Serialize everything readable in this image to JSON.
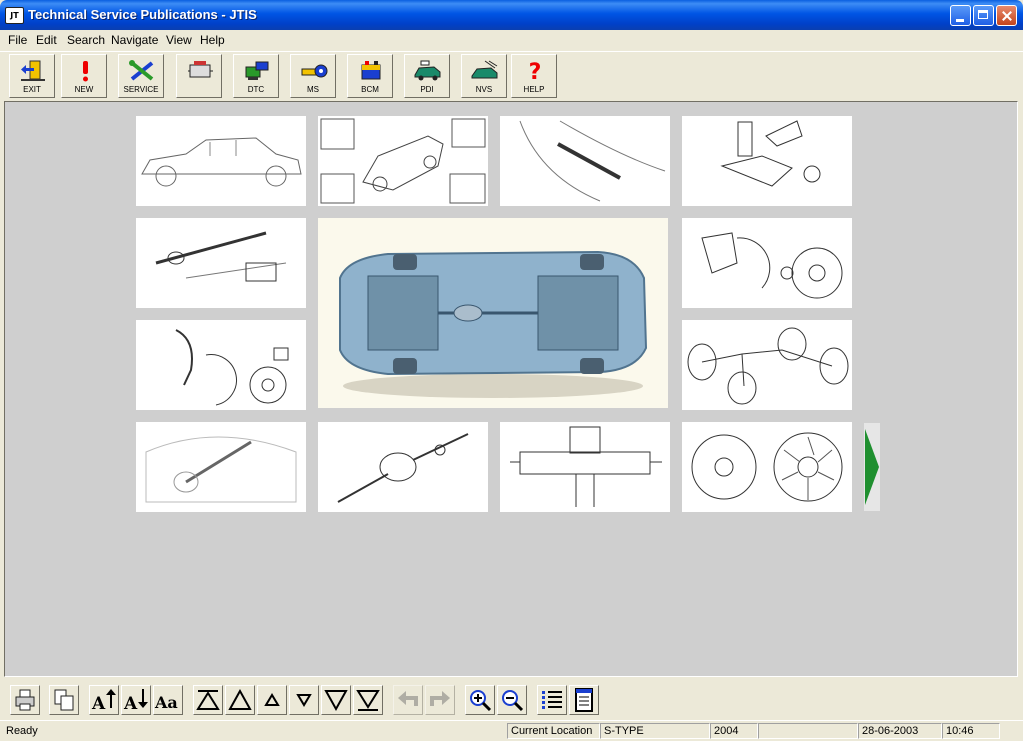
{
  "window": {
    "title": "Technical Service Publications - JTIS",
    "icon": "jtis-app-icon"
  },
  "menu": [
    "File",
    "Edit",
    "Search",
    "Navigate",
    "View",
    "Help"
  ],
  "toolbar": [
    {
      "label": "EXIT",
      "icon": "exit-door-icon"
    },
    {
      "label": "NEW",
      "icon": "exclamation-icon"
    },
    {
      "label": "SERVICE",
      "icon": "wrench-screwdriver-icon"
    },
    {
      "label": "",
      "icon": "engine-block-icon"
    },
    {
      "label": "DTC",
      "icon": "dtc-connector-icon"
    },
    {
      "label": "MS",
      "icon": "ms-tool-icon"
    },
    {
      "label": "BCM",
      "icon": "battery-icon"
    },
    {
      "label": "PDI",
      "icon": "car-inspection-icon"
    },
    {
      "label": "NVS",
      "icon": "nvs-car-icon"
    },
    {
      "label": "HELP",
      "icon": "help-question-icon"
    }
  ],
  "gallery": [
    "side-view-car-thumbnail",
    "car-components-thumbnail",
    "shock-absorber-thumbnail",
    "front-suspension-thumbnail",
    "driveshaft-thumbnail",
    "underbody-featured-image",
    "rear-hub-brake-thumbnail",
    "front-hub-brake-thumbnail",
    "brake-lines-thumbnail",
    "steering-rack-thumbnail",
    "rear-axle-thumbnail",
    "subframe-thumbnail",
    "wheels-thumbnail"
  ],
  "bottom_toolbar": [
    "print-icon",
    "copy-icon",
    "font-increase-icon",
    "font-decrease-icon",
    "font-style-icon",
    "first-page-icon",
    "page-up-icon",
    "line-up-icon",
    "line-down-icon",
    "page-down-icon",
    "last-page-icon",
    "back-icon",
    "forward-icon",
    "zoom-in-icon",
    "zoom-out-icon",
    "contents-list-icon",
    "document-icon"
  ],
  "status": {
    "state": "Ready",
    "location_label": "Current Location",
    "model": "S-TYPE",
    "year": "2004",
    "blank": "",
    "date": "28-06-2003",
    "time": "10:46"
  }
}
